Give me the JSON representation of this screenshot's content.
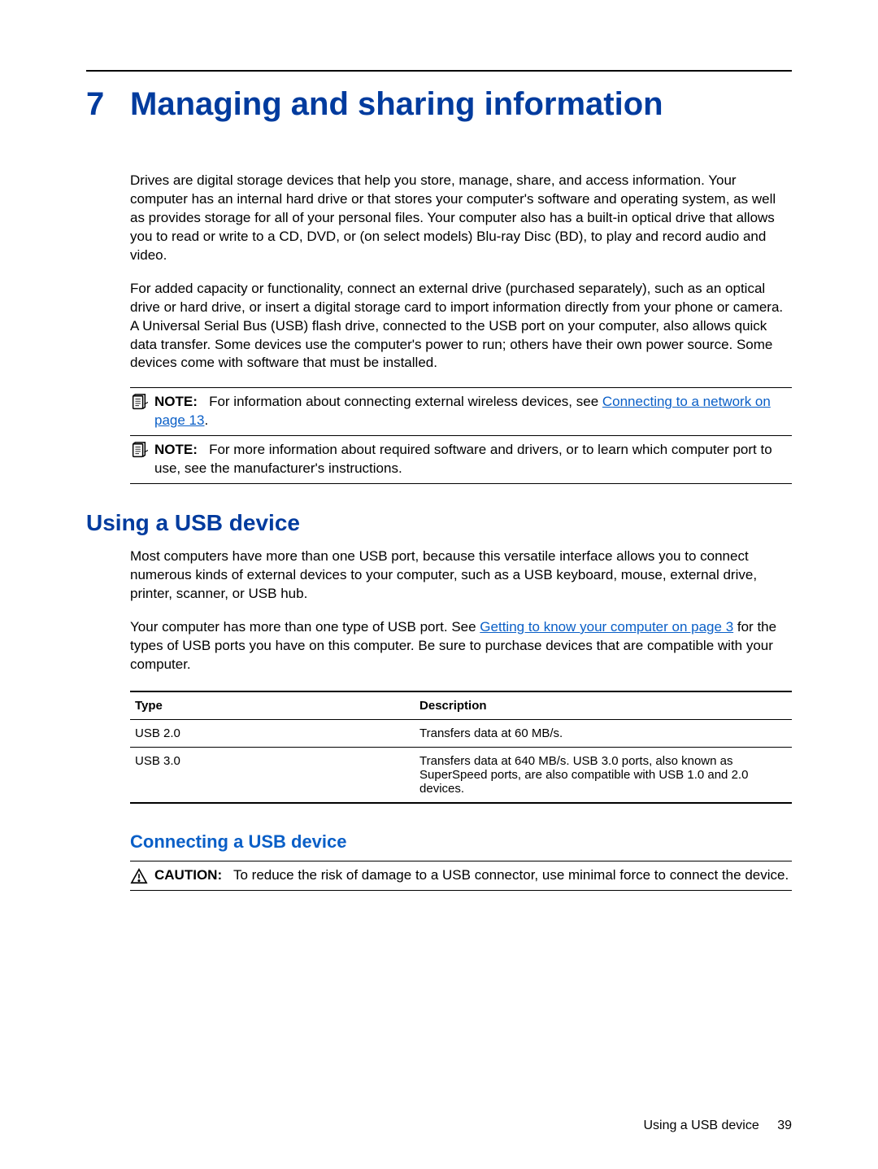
{
  "chapter": {
    "number": "7",
    "title": "Managing and sharing information"
  },
  "intro": {
    "p1": "Drives are digital storage devices that help you store, manage, share, and access information. Your computer has an internal hard drive or that stores your computer's software and operating system, as well as provides storage for all of your personal files. Your computer also has a built-in optical drive that allows you to read or write to a CD, DVD, or (on select models) Blu-ray Disc (BD), to play and record audio and video.",
    "p2": "For added capacity or functionality, connect an external drive (purchased separately), such as an optical drive or hard drive, or insert a digital storage card to import information directly from your phone or camera. A Universal Serial Bus (USB) flash drive, connected to the USB port on your computer, also allows quick data transfer. Some devices use the computer's power to run; others have their own power source. Some devices come with software that must be installed."
  },
  "notes": {
    "label": "NOTE:",
    "n1_pre": "For information about connecting external wireless devices, see ",
    "n1_link": "Connecting to a network on page 13",
    "n1_post": ".",
    "n2": "For more information about required software and drivers, or to learn which computer port to use, see the manufacturer's instructions."
  },
  "usb": {
    "heading": "Using a USB device",
    "p1": "Most computers have more than one USB port, because this versatile interface allows you to connect numerous kinds of external devices to your computer, such as a USB keyboard, mouse, external drive, printer, scanner, or USB hub.",
    "p2_pre": "Your computer has more than one type of USB port. See ",
    "p2_link": "Getting to know your computer on page 3",
    "p2_post": " for the types of USB ports you have on this computer. Be sure to purchase devices that are compatible with your computer.",
    "table": {
      "h1": "Type",
      "h2": "Description",
      "rows": [
        {
          "type": "USB 2.0",
          "desc": "Transfers data at 60 MB/s."
        },
        {
          "type": "USB 3.0",
          "desc": "Transfers data at 640 MB/s. USB 3.0 ports, also known as SuperSpeed ports, are also compatible with USB 1.0 and 2.0 devices."
        }
      ]
    }
  },
  "connect": {
    "heading": "Connecting a USB device",
    "caution_label": "CAUTION:",
    "caution_text": "To reduce the risk of damage to a USB connector, use minimal force to connect the device."
  },
  "footer": {
    "section": "Using a USB device",
    "page": "39"
  }
}
